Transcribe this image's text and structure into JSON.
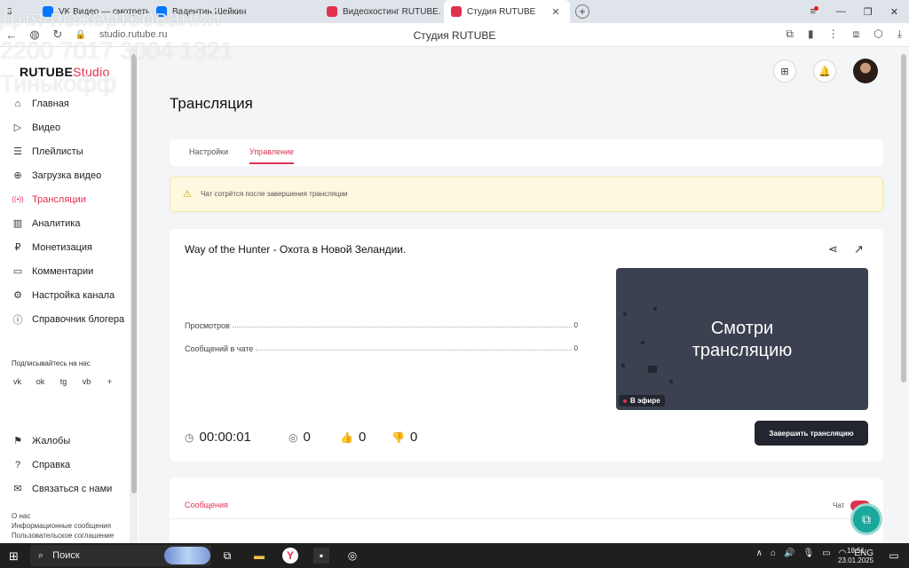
{
  "browser": {
    "tabs": [
      {
        "label": "3",
        "color": "#777777",
        "active": false
      },
      {
        "label": "VK Видео — смотреть он",
        "color": "#0077ff",
        "active": false
      },
      {
        "label": "Вадентин Шейкин",
        "color": "#0077ff",
        "active": false
      },
      {
        "label": "Видеохостинг RUTUBE. С",
        "color": "#e0324f",
        "active": false
      },
      {
        "label": "Студия RUTUBE",
        "color": "#e0324f",
        "active": true
      }
    ],
    "url": "studio.rutube.ru",
    "page_title": "Студия RUTUBE"
  },
  "watermark": {
    "line1": "Для пожертвований",
    "line2": "2200 7017 3004 1321",
    "line3": "Тинькофф"
  },
  "sidebar": {
    "logo_main": "RUTUBE",
    "logo_suffix": "Studio",
    "items": [
      {
        "label": "Главная",
        "icon": "home-icon",
        "glyph": "⌂"
      },
      {
        "label": "Видео",
        "icon": "video-icon",
        "glyph": "▷"
      },
      {
        "label": "Плейлисты",
        "icon": "playlist-icon",
        "glyph": "☰"
      },
      {
        "label": "Загрузка видео",
        "icon": "upload-icon",
        "glyph": "⊕"
      },
      {
        "label": "Трансляции",
        "icon": "broadcast-icon",
        "glyph": "((•))"
      },
      {
        "label": "Аналитика",
        "icon": "analytics-icon",
        "glyph": "▥"
      },
      {
        "label": "Монетизация",
        "icon": "money-icon",
        "glyph": "₽"
      },
      {
        "label": "Комментарии",
        "icon": "comments-icon",
        "glyph": "▭"
      },
      {
        "label": "Настройка канала",
        "icon": "gear-icon",
        "glyph": "⚙"
      },
      {
        "label": "Справочник блогера",
        "icon": "info-icon",
        "glyph": "ⓘ"
      }
    ],
    "follow_label": "Подписывайтесь на нас",
    "socials": [
      "vk",
      "ok",
      "tg",
      "vb",
      "+"
    ],
    "bottom_items": [
      {
        "label": "Жалобы",
        "icon": "flag-icon",
        "glyph": "⚑"
      },
      {
        "label": "Справка",
        "icon": "help-icon",
        "glyph": "?"
      },
      {
        "label": "Связаться с нами",
        "icon": "mail-icon",
        "glyph": "✉"
      }
    ],
    "footer": [
      "О нас",
      "Информационные сообщения",
      "Пользовательское соглашение"
    ]
  },
  "main": {
    "title": "Трансляция",
    "tabs": [
      "Настройки",
      "Управление"
    ],
    "warning": "Чат сотрётся после завершения трансляции",
    "stream_title": "Way of the Hunter - Охота в Новой Зеландии.",
    "stats": [
      {
        "label": "Просмотров",
        "value": "0"
      },
      {
        "label": "Сообщений в чате",
        "value": "0"
      }
    ],
    "preview_line1": "Смотри",
    "preview_line2": "трансляцию",
    "live_label": "В эфире",
    "duration": "00:00:01",
    "viewers": "0",
    "likes": "0",
    "dislikes": "0",
    "end_button": "Завершить трансляцию",
    "messages_tab": "Сообщения",
    "chat_label": "Чат"
  },
  "taskbar": {
    "search": "Поиск",
    "lang": "ENG",
    "time": "18:51",
    "date": "23.01.2025"
  },
  "colors": {
    "accent": "#e0324f",
    "dark": "#23262e",
    "warning_bg": "#fdf8df"
  }
}
